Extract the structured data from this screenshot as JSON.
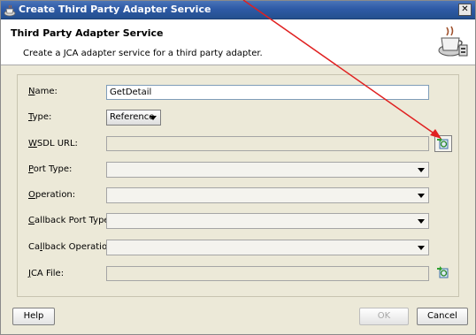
{
  "window": {
    "title": "Create Third Party Adapter Service",
    "close_glyph": "✕"
  },
  "header": {
    "title": "Third Party Adapter Service",
    "description": "Create a JCA adapter service for a third party adapter."
  },
  "form": {
    "name": {
      "access_key": "N",
      "label_rest": "ame:",
      "value": "GetDetail"
    },
    "type": {
      "access_key": "T",
      "label_rest": "ype:",
      "value": "Reference"
    },
    "wsdl_url": {
      "label_pre": "",
      "access_key": "W",
      "label_rest": "SDL URL:",
      "value": ""
    },
    "port_type": {
      "access_key": "P",
      "label_rest": "ort Type:",
      "value": ""
    },
    "operation": {
      "access_key": "O",
      "label_rest": "peration:",
      "value": ""
    },
    "callback_port_type": {
      "access_key": "C",
      "label_rest": "allback Port Type:",
      "value": ""
    },
    "callback_operation": {
      "label_pre": "Ca",
      "access_key": "l",
      "label_rest": "lback Operation:",
      "value": ""
    },
    "jca_file": {
      "access_key": "J",
      "label_rest": "CA File:",
      "value": ""
    }
  },
  "buttons": {
    "help": "Help",
    "ok": "OK",
    "cancel": "Cancel"
  },
  "icons": {
    "title": "coffee-cup-icon",
    "header": "coffee-cup-adapter-icon",
    "browse": "browse-wsdl-icon"
  },
  "colors": {
    "annotation_arrow": "#e02020",
    "titlebar": "#2e5aa6"
  }
}
